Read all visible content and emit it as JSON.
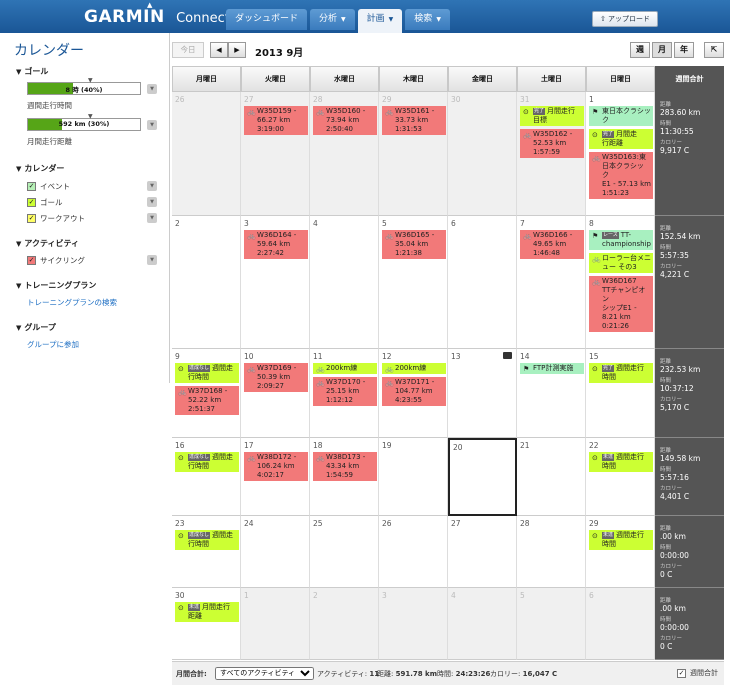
{
  "brand": {
    "name": "GARMIN",
    "product": "Connect",
    "triangle": "▲"
  },
  "nav": {
    "tabs": [
      {
        "label": "ダッシュボード",
        "caret": ""
      },
      {
        "label": "分析",
        "caret": "▼"
      },
      {
        "label": "計画",
        "caret": "▼"
      },
      {
        "label": "検索",
        "caret": "▼"
      }
    ],
    "upload_label": "⇧ アップロード"
  },
  "sidebar": {
    "title": "カレンダー",
    "goals": {
      "heading": "ゴール",
      "items": [
        {
          "bar_text": "8 時 (40%)",
          "label": "週間走行時間",
          "percent": 40
        },
        {
          "bar_text": "592 km (30%)",
          "label": "月間走行距離",
          "percent": 30
        }
      ]
    },
    "calendars": {
      "heading": "カレンダー",
      "items": [
        {
          "label": "イベント",
          "color": "#b6f0b6"
        },
        {
          "label": "ゴール",
          "color": "#ccff33"
        },
        {
          "label": "ワークアウト",
          "color": "#ffff66"
        }
      ]
    },
    "activities": {
      "heading": "アクティビティ",
      "items": [
        {
          "label": "サイクリング",
          "color": "#f27979"
        }
      ]
    },
    "training": {
      "heading": "トレーニングプラン",
      "link": "トレーニングプランの検索"
    },
    "groups": {
      "heading": "グループ",
      "link": "グループに参加"
    }
  },
  "calendar": {
    "today_label": "今日",
    "prev": "◀",
    "next": "▶",
    "month_label": "2013 9月",
    "views": [
      "週",
      "月",
      "年"
    ],
    "share_icon": "⇱",
    "weekday_headers": [
      "月曜日",
      "火曜日",
      "水曜日",
      "木曜日",
      "金曜日",
      "土曜日",
      "日曜日",
      "週間合計"
    ],
    "weeks": [
      {
        "days": [
          {
            "num": "26",
            "other": true,
            "events": []
          },
          {
            "num": "27",
            "other": true,
            "events": [
              {
                "type": "red",
                "icon": "bike",
                "lines": [
                  "W35D159 -",
                  "66.27 km",
                  "3:19:00"
                ]
              }
            ]
          },
          {
            "num": "28",
            "other": true,
            "events": [
              {
                "type": "red",
                "icon": "bike",
                "lines": [
                  "W35D160 -",
                  "73.94 km",
                  "2:50:40"
                ]
              }
            ]
          },
          {
            "num": "29",
            "other": true,
            "events": [
              {
                "type": "red",
                "icon": "bike",
                "lines": [
                  "W35D161 -",
                  "33.73 km",
                  "1:31:53"
                ]
              }
            ]
          },
          {
            "num": "30",
            "other": true,
            "events": []
          },
          {
            "num": "31",
            "other": true,
            "events": [
              {
                "type": "yel",
                "icon": "goal",
                "badge": "完了",
                "lines": [
                  "月間走行",
                  "目標"
                ]
              },
              {
                "type": "red",
                "icon": "bike",
                "lines": [
                  "W35D162 -",
                  "52.53 km",
                  "1:57:59"
                ]
              }
            ]
          },
          {
            "num": "1",
            "other": false,
            "events": [
              {
                "type": "grn",
                "icon": "flag",
                "lines": [
                  "東日本クラシッ",
                  "ク"
                ]
              },
              {
                "type": "yel",
                "icon": "goal",
                "badge": "完了",
                "lines": [
                  "月間走",
                  "行距離"
                ]
              },
              {
                "type": "red",
                "icon": "bike",
                "lines": [
                  "W35D163:東",
                  "日本クラシッ",
                  "ク",
                  "E1 - 57.13 km",
                  "1:51:23"
                ]
              }
            ]
          }
        ],
        "summary": {
          "distance_label": "距離",
          "distance": "283.60 km",
          "time_label": "時間",
          "time": "11:30:55",
          "cal_label": "カロリー",
          "calories": "9,917 C"
        }
      },
      {
        "days": [
          {
            "num": "2",
            "other": false,
            "events": []
          },
          {
            "num": "3",
            "other": false,
            "events": [
              {
                "type": "red",
                "icon": "bike",
                "lines": [
                  "W36D164 -",
                  "59.64 km",
                  "2:27:42"
                ]
              }
            ]
          },
          {
            "num": "4",
            "other": false,
            "events": []
          },
          {
            "num": "5",
            "other": false,
            "events": [
              {
                "type": "red",
                "icon": "bike",
                "lines": [
                  "W36D165 -",
                  "35.04 km",
                  "1:21:38"
                ]
              }
            ]
          },
          {
            "num": "6",
            "other": false,
            "events": []
          },
          {
            "num": "7",
            "other": false,
            "events": [
              {
                "type": "red",
                "icon": "bike",
                "lines": [
                  "W36D166 -",
                  "49.65 km",
                  "1:46:48"
                ]
              }
            ]
          },
          {
            "num": "8",
            "other": false,
            "events": [
              {
                "type": "grn",
                "icon": "flag",
                "badge": "レース",
                "lines": [
                  "TT-",
                  "championship"
                ]
              },
              {
                "type": "yel",
                "icon": "bike",
                "lines": [
                  "ローラー台メニ",
                  "ュー その3"
                ]
              },
              {
                "type": "red",
                "icon": "bike",
                "lines": [
                  "W36D167",
                  "TTチャンピオン",
                  "シップE1 -",
                  "8.21 km",
                  "0:21:26"
                ]
              }
            ]
          }
        ],
        "summary": {
          "distance_label": "距離",
          "distance": "152.54 km",
          "time_label": "時間",
          "time": "5:57:35",
          "cal_label": "カロリー",
          "calories": "4,221 C"
        }
      },
      {
        "days": [
          {
            "num": "9",
            "other": false,
            "events": [
              {
                "type": "yel",
                "icon": "goal",
                "badge": "達成なし",
                "lines": [
                  "週間走",
                  "行時間"
                ]
              },
              {
                "type": "red",
                "icon": "bike",
                "lines": [
                  "W37D168 -",
                  "52.22 km",
                  "2:51:37"
                ]
              }
            ]
          },
          {
            "num": "10",
            "other": false,
            "events": [
              {
                "type": "red",
                "icon": "bike",
                "lines": [
                  "W37D169 -",
                  "50.39 km",
                  "2:09:27"
                ]
              }
            ]
          },
          {
            "num": "11",
            "other": false,
            "events": [
              {
                "type": "yel",
                "icon": "bike",
                "lines": [
                  "200km練"
                ]
              },
              {
                "type": "red",
                "icon": "bike",
                "lines": [
                  "W37D170 -",
                  "25.15 km",
                  "1:12:12"
                ]
              }
            ]
          },
          {
            "num": "12",
            "other": false,
            "events": [
              {
                "type": "yel",
                "icon": "bike",
                "lines": [
                  "200km練"
                ]
              },
              {
                "type": "red",
                "icon": "bike",
                "lines": [
                  "W37D171 -",
                  "104.77 km",
                  "4:23:55"
                ]
              }
            ]
          },
          {
            "num": "13",
            "other": false,
            "note": true,
            "events": []
          },
          {
            "num": "14",
            "other": false,
            "events": [
              {
                "type": "grn",
                "icon": "flag",
                "lines": [
                  "FTP計測実施"
                ]
              }
            ]
          },
          {
            "num": "15",
            "other": false,
            "events": [
              {
                "type": "yel",
                "icon": "goal",
                "badge": "完了",
                "lines": [
                  "週間走行",
                  "時間"
                ]
              }
            ]
          }
        ],
        "summary": {
          "distance_label": "距離",
          "distance": "232.53 km",
          "time_label": "時間",
          "time": "10:37:12",
          "cal_label": "カロリー",
          "calories": "5,170 C"
        }
      },
      {
        "days": [
          {
            "num": "16",
            "other": false,
            "events": [
              {
                "type": "yel",
                "icon": "goal",
                "badge": "達成なし",
                "lines": [
                  "週間走",
                  "行時間"
                ]
              }
            ]
          },
          {
            "num": "17",
            "other": false,
            "events": [
              {
                "type": "red",
                "icon": "bike",
                "lines": [
                  "W38D172 -",
                  "106.24 km",
                  "4:02:17"
                ]
              }
            ]
          },
          {
            "num": "18",
            "other": false,
            "events": [
              {
                "type": "red",
                "icon": "bike",
                "lines": [
                  "W38D173 -",
                  "43.34 km",
                  "1:54:59"
                ]
              }
            ]
          },
          {
            "num": "19",
            "other": false,
            "events": []
          },
          {
            "num": "20",
            "other": false,
            "today": true,
            "events": []
          },
          {
            "num": "21",
            "other": false,
            "events": []
          },
          {
            "num": "22",
            "other": false,
            "events": [
              {
                "type": "yel",
                "icon": "goal",
                "badge": "未達",
                "lines": [
                  "週間走行",
                  "時間"
                ]
              }
            ]
          }
        ],
        "summary": {
          "distance_label": "距離",
          "distance": "149.58 km",
          "time_label": "時間",
          "time": "5:57:16",
          "cal_label": "カロリー",
          "calories": "4,401 C"
        }
      },
      {
        "days": [
          {
            "num": "23",
            "other": false,
            "events": [
              {
                "type": "yel",
                "icon": "goal",
                "badge": "達成なし",
                "lines": [
                  "週間走",
                  "行時間"
                ]
              }
            ]
          },
          {
            "num": "24",
            "other": false,
            "events": []
          },
          {
            "num": "25",
            "other": false,
            "events": []
          },
          {
            "num": "26",
            "other": false,
            "events": []
          },
          {
            "num": "27",
            "other": false,
            "events": []
          },
          {
            "num": "28",
            "other": false,
            "events": []
          },
          {
            "num": "29",
            "other": false,
            "events": [
              {
                "type": "yel",
                "icon": "goal",
                "badge": "未達",
                "lines": [
                  "週間走行",
                  "時間"
                ]
              }
            ]
          }
        ],
        "summary": {
          "distance_label": "距離",
          "distance": ".00 km",
          "time_label": "時間",
          "time": "0:00:00",
          "cal_label": "カロリー",
          "calories": "0 C"
        }
      },
      {
        "days": [
          {
            "num": "30",
            "other": false,
            "events": [
              {
                "type": "yel",
                "icon": "goal",
                "badge": "未達",
                "lines": [
                  "月間走行",
                  "距離"
                ]
              }
            ]
          },
          {
            "num": "1",
            "other": true,
            "events": []
          },
          {
            "num": "2",
            "other": true,
            "events": []
          },
          {
            "num": "3",
            "other": true,
            "events": []
          },
          {
            "num": "4",
            "other": true,
            "events": []
          },
          {
            "num": "5",
            "other": true,
            "events": []
          },
          {
            "num": "6",
            "other": true,
            "events": []
          }
        ],
        "summary": {
          "distance_label": "距離",
          "distance": ".00 km",
          "time_label": "時間",
          "time": "0:00:00",
          "cal_label": "カロリー",
          "calories": "0 C"
        }
      }
    ]
  },
  "footer": {
    "month_total_label": "月間合計:",
    "filter_value": "すべてのアクティビティ",
    "activities_label": "アクティビティ:",
    "activities": "11",
    "distance_label": "距離:",
    "distance": "591.78 km",
    "time_label": "時間:",
    "time": "24:23:26",
    "calories_label": "カロリー:",
    "calories": "16,047 C",
    "weekly_total_label": "週間合計",
    "weekly_total_checked": true
  }
}
